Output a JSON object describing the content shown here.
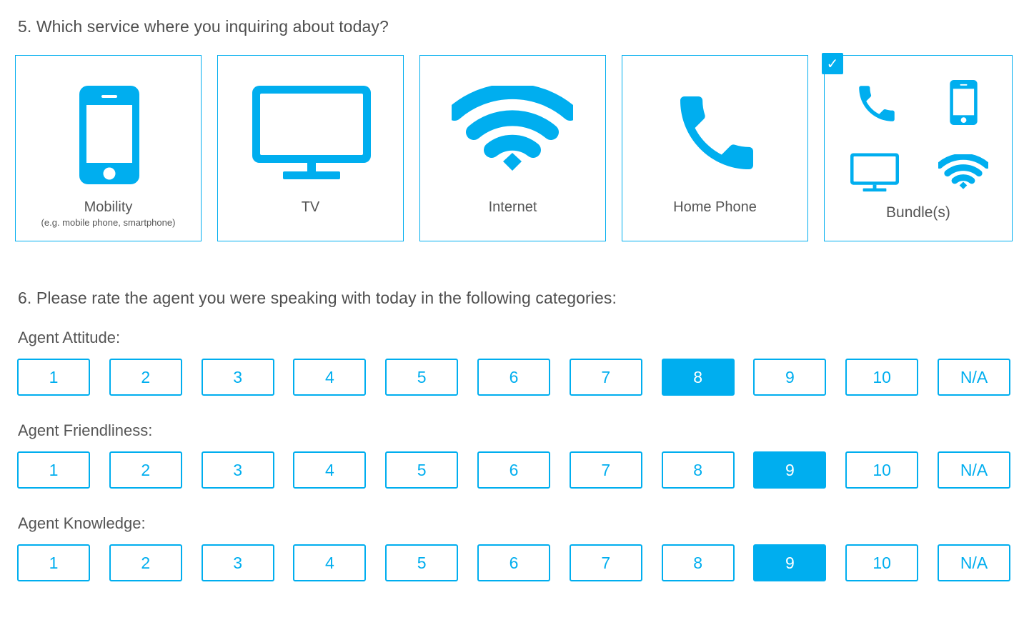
{
  "accent_color": "#00aeef",
  "question5": {
    "title": "5. Which service where you inquiring about today?",
    "services": [
      {
        "label": "Mobility",
        "sublabel": "(e.g. mobile phone, smartphone)",
        "icon": "smartphone-icon",
        "selected": false
      },
      {
        "label": "TV",
        "icon": "tv-icon",
        "selected": false
      },
      {
        "label": "Internet",
        "icon": "wifi-icon",
        "selected": false
      },
      {
        "label": "Home Phone",
        "icon": "phone-icon",
        "selected": false
      },
      {
        "label": "Bundle(s)",
        "icon": "bundle-icon",
        "selected": true,
        "check": "✓"
      }
    ]
  },
  "question6": {
    "title": "6. Please rate the agent you were speaking with today in the following categories:",
    "options": [
      "1",
      "2",
      "3",
      "4",
      "5",
      "6",
      "7",
      "8",
      "9",
      "10",
      "N/A"
    ],
    "categories": [
      {
        "label": "Agent Attitude:",
        "selected": "8"
      },
      {
        "label": "Agent Friendliness:",
        "selected": "9"
      },
      {
        "label": "Agent Knowledge:",
        "selected": "9"
      }
    ]
  }
}
